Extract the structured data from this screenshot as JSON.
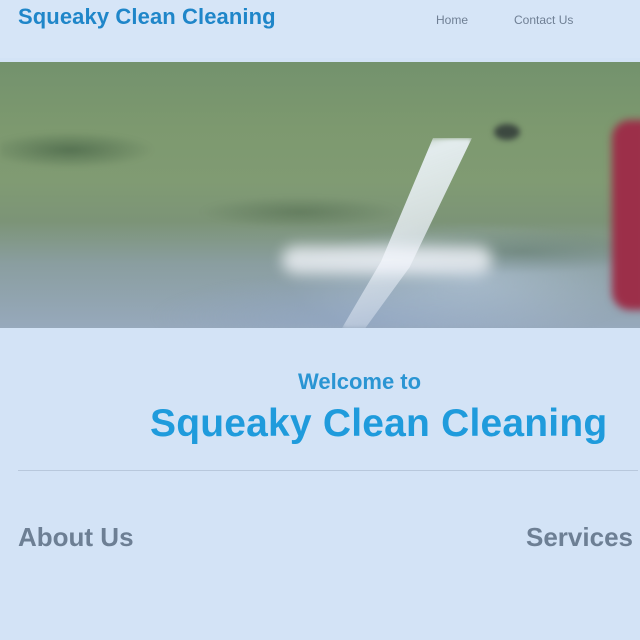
{
  "header": {
    "brand": "Squeaky Clean Cleaning",
    "nav": [
      {
        "label": "Home"
      },
      {
        "label": "Contact Us"
      }
    ]
  },
  "hero": {
    "alt": "pressure washing"
  },
  "welcome": {
    "small": "Welcome to",
    "big": "Squeaky Clean Cleaning"
  },
  "about": {
    "title": "About Us",
    "paragraphs": [
      "",
      ""
    ]
  },
  "services": {
    "title": "Services",
    "items": [
      "",
      "",
      "",
      "",
      ""
    ]
  },
  "colors": {
    "page_bg": "#d3e3f6",
    "brand_blue": "#1f86c9",
    "heading_gray": "#6d7f94"
  }
}
